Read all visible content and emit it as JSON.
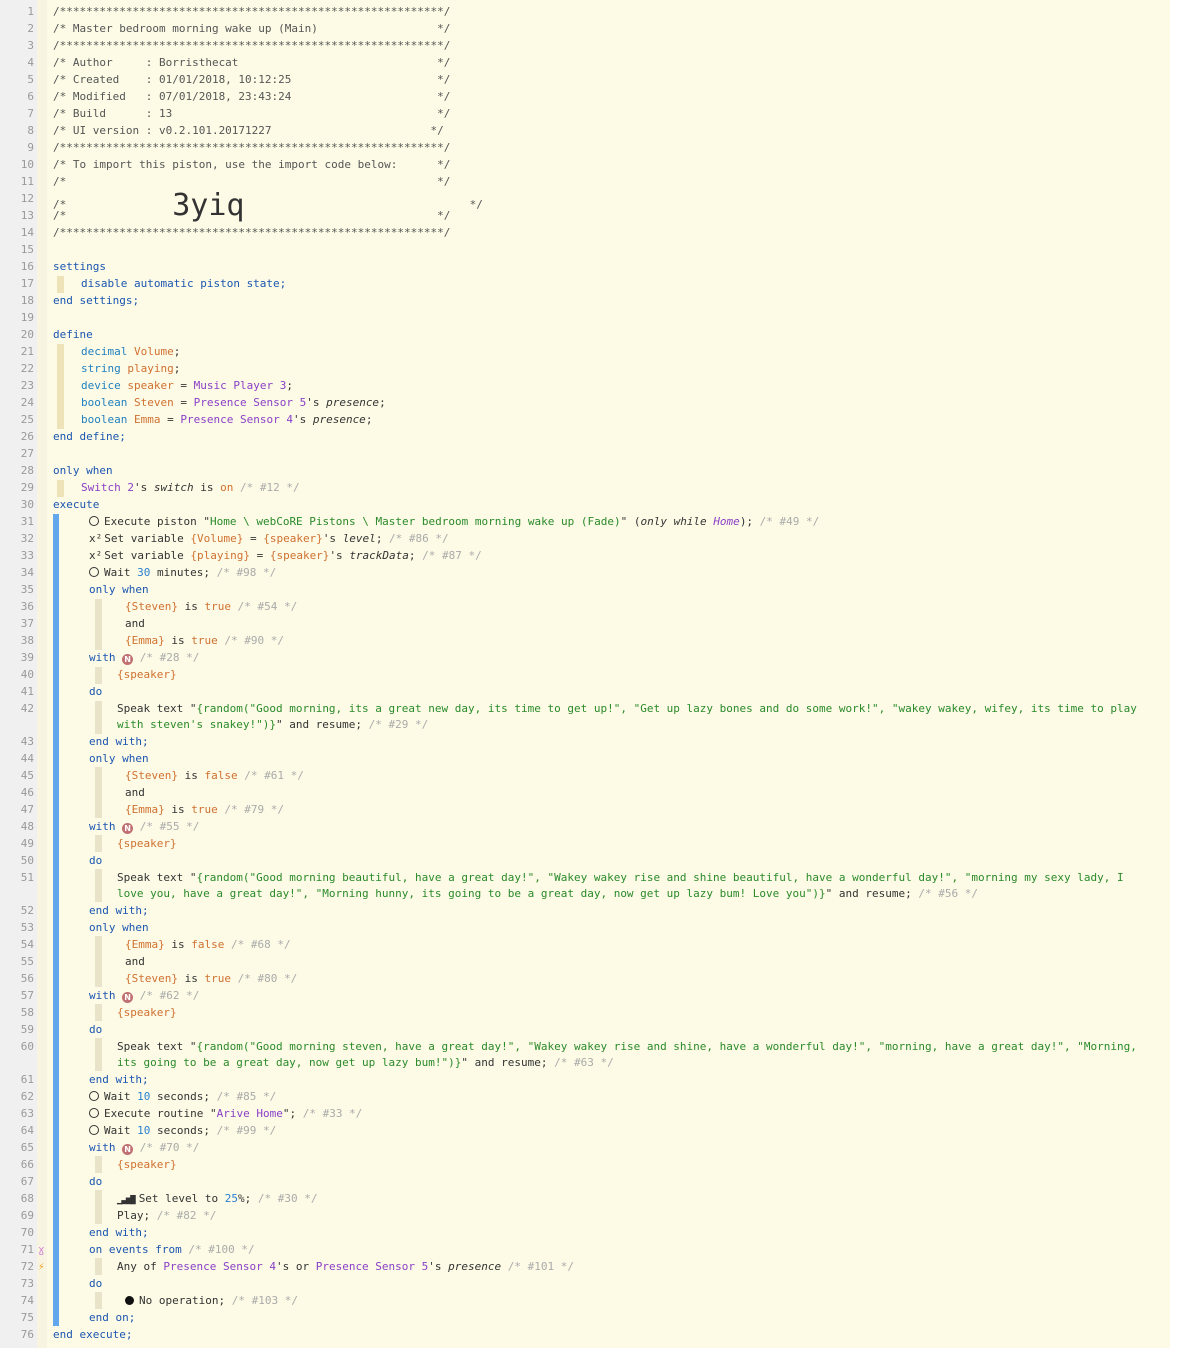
{
  "header": {
    "border": "/**********************************************************/",
    "title": "/* Master bedroom morning wake up (Main)                  */",
    "author": "/* Author     : Borristhecat                              */",
    "created": "/* Created    : 01/01/2018, 10:12:25                      */",
    "modified": "/* Modified   : 07/01/2018, 23:43:24                      */",
    "build": "/* Build      : 13                                        */",
    "ui_version": "/* UI version : v0.2.101.20171227                        */",
    "import_note": "/* To import this piston, use the import code below:      */",
    "blank": "/*                                                        */",
    "code_prefix": "/*                ",
    "import_code": "3yiq",
    "code_suffix": "                                  */"
  },
  "settings": {
    "open": "settings",
    "line": "disable automatic piston state;",
    "close": "end settings;"
  },
  "define": {
    "open": "define",
    "close": "end define;"
  },
  "k": {
    "only_when": "only when",
    "execute": "execute",
    "with": "with",
    "do": "do",
    "end_with": "end with;",
    "and": "and",
    "is": "is",
    "true": "true",
    "false": "false",
    "speaker": "{speaker}",
    "steven": "{Steven}",
    "emma": "{Emma}",
    "on_events": "on events from",
    "end_on": "end on;",
    "end_execute": "end execute;"
  },
  "lines": {
    "l21": {
      "type": "decimal",
      "name": "Volume",
      "semi": ";"
    },
    "l22": {
      "type": "string",
      "name": "playing",
      "semi": ";"
    },
    "l23": {
      "type": "device",
      "name": "speaker",
      "eq": " = ",
      "dev": "Music Player 3",
      "semi": ";"
    },
    "l24": {
      "type": "boolean",
      "name": "Steven",
      "eq": " = ",
      "dev": "Presence Sensor 5",
      "s": "'s ",
      "attr": "presence",
      "semi": ";"
    },
    "l25": {
      "type": "boolean",
      "name": "Emma",
      "eq": " = ",
      "dev": "Presence Sensor 4",
      "s": "'s ",
      "attr": "presence",
      "semi": ";"
    },
    "l29": {
      "dev": "Switch 2",
      "s": "'s ",
      "attr": "switch",
      "is": " is ",
      "val": "on",
      "id": " /* #12 */"
    },
    "l31": {
      "a": "Execute piston \"",
      "str": "Home \\ webCoRE Pistons \\ Master bedroom morning wake up (Fade)",
      "b": "\" (",
      "c": "only while ",
      "d": "Home",
      "e": ");",
      "id": " /* #49 */"
    },
    "l32": {
      "a": "Set variable ",
      "var": "{Volume}",
      "b": " = ",
      "var2": "{speaker}",
      "s": "'s ",
      "attr": "level",
      "semi": ";",
      "id": " /* #86 */"
    },
    "l33": {
      "a": "Set variable ",
      "var": "{playing}",
      "b": " = ",
      "var2": "{speaker}",
      "s": "'s ",
      "attr": "trackData",
      "semi": ";",
      "id": " /* #87 */"
    },
    "l34": {
      "a": "Wait ",
      "num": "30",
      "b": " minutes;",
      "id": " /* #98 */"
    },
    "l36id": " /* #54 */",
    "l38id": " /* #90 */",
    "l39id": " /* #28 */",
    "l42": {
      "a": "Speak text \"",
      "str": "{random(\"Good morning, its a great new day, its time to get up!\", \"Get up lazy bones and do some work!\", \"wakey wakey, wifey, its time to play with steven's snakey!\")}",
      "b": "\" and resume;",
      "id": " /* #29 */"
    },
    "l45id": " /* #61 */",
    "l47id": " /* #79 */",
    "l48id": " /* #55 */",
    "l51": {
      "a": "Speak text \"",
      "str": "{random(\"Good morning beautiful, have a great day!\", \"Wakey wakey rise and shine beautiful, have a wonderful day!\", \"morning my sexy lady, I love you, have a great day!\", \"Morning hunny, its going to be a great day, now get up lazy bum! Love you\")}",
      "b": "\" and resume;",
      "id": " /* #56 */"
    },
    "l54id": " /* #68 */",
    "l56id": " /* #80 */",
    "l57id": " /* #62 */",
    "l60": {
      "a": "Speak text \"",
      "str": "{random(\"Good morning steven, have a great day!\", \"Wakey wakey rise and shine, have a wonderful day!\", \"morning, have a great day!\", \"Morning, its going to be a great day, now get up lazy bum!\")}",
      "b": "\" and resume;",
      "id": " /* #63 */"
    },
    "l62": {
      "a": "Wait ",
      "num": "10",
      "b": " seconds;",
      "id": " /* #85 */"
    },
    "l63": {
      "a": "Execute routine \"",
      "str": "Arive Home",
      "b": "\";",
      "id": " /* #33 */"
    },
    "l64": {
      "a": "Wait ",
      "num": "10",
      "b": " seconds;",
      "id": " /* #99 */"
    },
    "l65id": " /* #70 */",
    "l68": {
      "a": "Set level to ",
      "num": "25",
      "b": "%;",
      "id": " /* #30 */"
    },
    "l69": {
      "a": "Play;",
      "id": " /* #82 */"
    },
    "l71id": " /* #100 */",
    "l72": {
      "a": "Any of ",
      "dev": "Presence Sensor 4",
      "s": "'s or ",
      "dev2": "Presence Sensor 5",
      "s2": "'s ",
      "attr": "presence",
      "id": " /* #101 */"
    },
    "l74": {
      "a": "No operation;",
      "id": " /* #103 */"
    }
  },
  "icons": {
    "n": "N",
    "x2": "x²",
    "lvl": "▁▃▅▇",
    "trigger": "⚡",
    "event": "ɣ"
  },
  "line_numbers": [
    "1",
    "2",
    "3",
    "4",
    "5",
    "6",
    "7",
    "8",
    "9",
    "10",
    "11",
    "12",
    "13",
    "14",
    "15",
    "16",
    "17",
    "18",
    "19",
    "20",
    "21",
    "22",
    "23",
    "24",
    "25",
    "26",
    "27",
    "28",
    "29",
    "30",
    "31",
    "32",
    "33",
    "34",
    "35",
    "36",
    "37",
    "38",
    "39",
    "40",
    "41",
    "42",
    "43",
    "44",
    "45",
    "46",
    "47",
    "48",
    "49",
    "50",
    "51",
    "52",
    "53",
    "54",
    "55",
    "56",
    "57",
    "58",
    "59",
    "60",
    "61",
    "62",
    "63",
    "64",
    "65",
    "66",
    "67",
    "68",
    "69",
    "70",
    "71",
    "72",
    "73",
    "74",
    "75",
    "76"
  ]
}
